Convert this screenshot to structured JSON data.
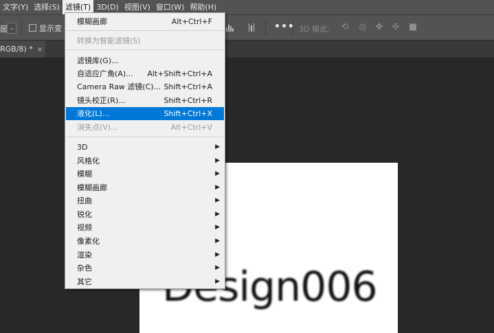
{
  "menubar": {
    "items": [
      {
        "label": "文字(Y)"
      },
      {
        "label": "选择(S)"
      },
      {
        "label": "滤镜(T)"
      },
      {
        "label": "3D(D)"
      },
      {
        "label": "视图(V)"
      },
      {
        "label": "窗口(W)"
      },
      {
        "label": "帮助(H)"
      }
    ]
  },
  "optionsbar": {
    "truncated_label": "层",
    "show_transform_label": "显示变",
    "more_label": "•••",
    "mode_3d_label": "3D 模式:"
  },
  "document_tab": {
    "label": "RGB/8) *",
    "close": "×"
  },
  "canvas": {
    "text": "Design006"
  },
  "filter_menu": {
    "items": [
      {
        "label": "模糊画廊",
        "shortcut": "Alt+Ctrl+F"
      },
      {
        "label": "转换为智能滤镜(S)",
        "shortcut": ""
      },
      {
        "label": "滤镜库(G)...",
        "shortcut": ""
      },
      {
        "label": "自适应广角(A)...",
        "shortcut": "Alt+Shift+Ctrl+A"
      },
      {
        "label": "Camera Raw 滤镜(C)...",
        "shortcut": "Shift+Ctrl+A"
      },
      {
        "label": "镜头校正(R)...",
        "shortcut": "Shift+Ctrl+R"
      },
      {
        "label": "液化(L)...",
        "shortcut": "Shift+Ctrl+X"
      },
      {
        "label": "消失点(V)...",
        "shortcut": "Alt+Ctrl+V"
      },
      {
        "label": "3D"
      },
      {
        "label": "风格化"
      },
      {
        "label": "模糊"
      },
      {
        "label": "模糊画廊"
      },
      {
        "label": "扭曲"
      },
      {
        "label": "锐化"
      },
      {
        "label": "视频"
      },
      {
        "label": "像素化"
      },
      {
        "label": "渲染"
      },
      {
        "label": "杂色"
      },
      {
        "label": "其它"
      }
    ],
    "submenu_arrow": "▶"
  },
  "colors": {
    "menubar_bg": "#535353",
    "workspace_bg": "#282828",
    "menu_bg": "#f0f0f0",
    "highlight": "#0078d7"
  }
}
